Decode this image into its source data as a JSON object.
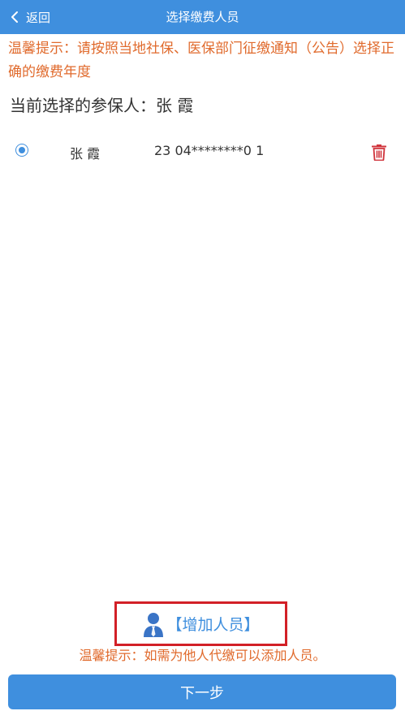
{
  "navbar": {
    "back_label": "返回",
    "title": "选择缴费人员"
  },
  "tip": {
    "text": "温馨提示：请按照当地社保、医保部门征缴通知（公告）选择正确的缴费年度"
  },
  "current_selection": {
    "label": "当前选择的参保人：",
    "name": "张 霞"
  },
  "persons": [
    {
      "name": "张 霞",
      "id_number": "23 04********0 1",
      "selected": true
    }
  ],
  "add_person": {
    "label": "【增加人员】",
    "icon": "person-icon"
  },
  "bottom_tip": "温馨提示：如需为他人代缴可以添加人员。",
  "next_button": "下一步",
  "colors": {
    "brand_blue": "#3f8fde",
    "tip_orange": "#e06a2c",
    "delete_red": "#d0333b",
    "highlight_red": "#d22027"
  }
}
